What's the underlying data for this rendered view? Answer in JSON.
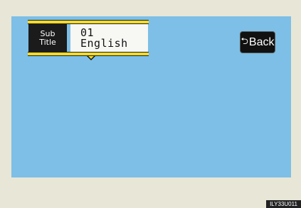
{
  "subtitle": {
    "label_line1": "Sub",
    "label_line2": "Title",
    "number": "01",
    "language": "English"
  },
  "back_button": {
    "icon": "back-arrow-icon",
    "label": "Back"
  },
  "footer": {
    "image_code": "ILY33U011"
  },
  "colors": {
    "screen_bg": "#7dbfe6",
    "frame_bg": "#e8e6d6",
    "highlight_bar": "#f2da2a",
    "button_bg": "#111111"
  }
}
